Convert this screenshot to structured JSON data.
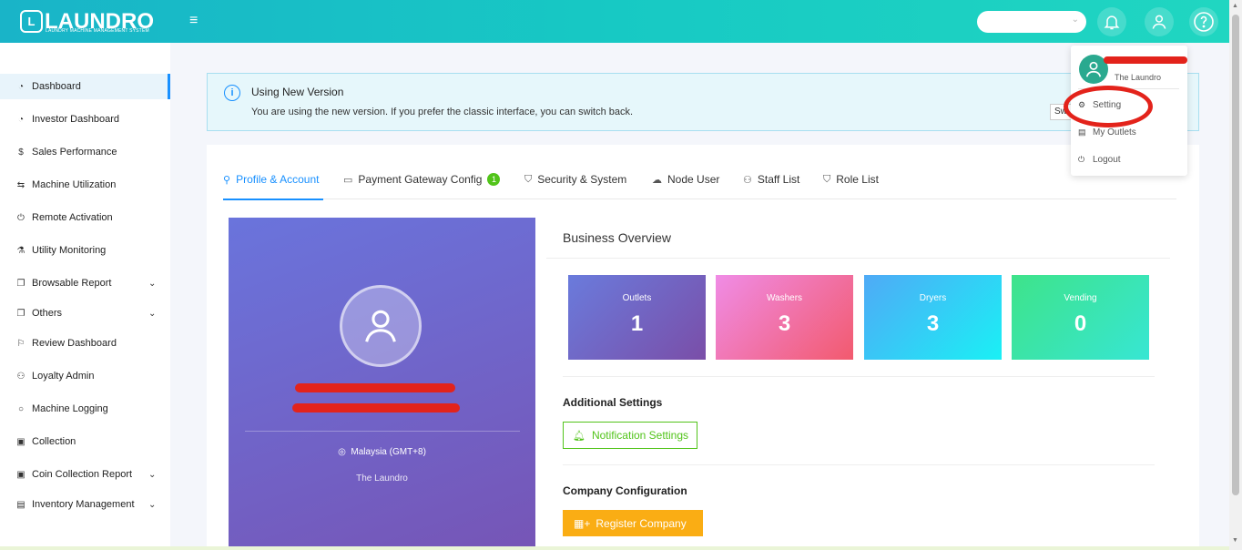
{
  "brand": {
    "logo_letter": "L",
    "name": "LAUNDRO",
    "tagline": "LAUNDRY MACHINE MANAGEMENT SYSTEM"
  },
  "topbar": {
    "menu_icon": "hamburger-icon",
    "select_value": "",
    "icons": [
      "bell-icon",
      "user-icon",
      "help-icon"
    ]
  },
  "sidebar": {
    "items": [
      {
        "label": "Dashboard",
        "icon": "dashboard-icon",
        "active": true
      },
      {
        "label": "Investor Dashboard",
        "icon": "dashboard-icon"
      },
      {
        "label": "Sales Performance",
        "icon": "dollar-icon"
      },
      {
        "label": "Machine Utilization",
        "icon": "swap-icon"
      },
      {
        "label": "Remote Activation",
        "icon": "power-icon"
      },
      {
        "label": "Utility Monitoring",
        "icon": "flask-icon"
      },
      {
        "label": "Browsable Report",
        "icon": "copy-icon",
        "expandable": true
      },
      {
        "label": "Others",
        "icon": "copy-icon",
        "expandable": true
      },
      {
        "label": "Review Dashboard",
        "icon": "flag-icon"
      },
      {
        "label": "Loyalty Admin",
        "icon": "users-icon"
      },
      {
        "label": "Machine Logging",
        "icon": "chat-icon"
      },
      {
        "label": "Collection",
        "icon": "file-icon"
      },
      {
        "label": "Coin Collection Report",
        "icon": "file-icon",
        "expandable": true
      },
      {
        "label": "Inventory Management",
        "icon": "table-icon",
        "expandable": true
      }
    ]
  },
  "alert": {
    "title": "Using New Version",
    "description": "You are using the new version. If you prefer the classic interface, you can switch back.",
    "switch_label": "Sw"
  },
  "tabs": [
    {
      "label": "Profile & Account",
      "icon": "user-icon",
      "active": true
    },
    {
      "label": "Payment Gateway Config",
      "icon": "card-icon",
      "badge": "1"
    },
    {
      "label": "Security & System",
      "icon": "shield-icon"
    },
    {
      "label": "Node User",
      "icon": "cloud-icon"
    },
    {
      "label": "Staff List",
      "icon": "team-icon"
    },
    {
      "label": "Role List",
      "icon": "shield-icon"
    }
  ],
  "profile": {
    "location": "Malaysia (GMT+8)",
    "company": "The Laundro"
  },
  "business": {
    "title": "Business Overview",
    "stats": [
      {
        "label": "Outlets",
        "value": "1",
        "gradient": [
          "#6a7bdc",
          "#7a4ea8"
        ]
      },
      {
        "label": "Washers",
        "value": "3",
        "gradient": [
          "#f08ce6",
          "#f25a6e"
        ]
      },
      {
        "label": "Dryers",
        "value": "3",
        "gradient": [
          "#4faaf6",
          "#1af0f5"
        ]
      },
      {
        "label": "Vending",
        "value": "0",
        "gradient": [
          "#3ee38a",
          "#37e6d3"
        ]
      }
    ]
  },
  "additional": {
    "title": "Additional Settings",
    "notification_button": "Notification Settings"
  },
  "company_config": {
    "title": "Company Configuration",
    "register_button": "Register Company"
  },
  "dropdown": {
    "company": "The Laundro",
    "items": [
      {
        "label": "Setting",
        "icon": "gear-icon"
      },
      {
        "label": "My Outlets",
        "icon": "shop-icon"
      },
      {
        "label": "Logout",
        "icon": "power-icon"
      }
    ]
  },
  "colors": {
    "primary": "#1890ff",
    "success": "#52c41a",
    "warning": "#faad14",
    "redaction": "#e3231b"
  }
}
